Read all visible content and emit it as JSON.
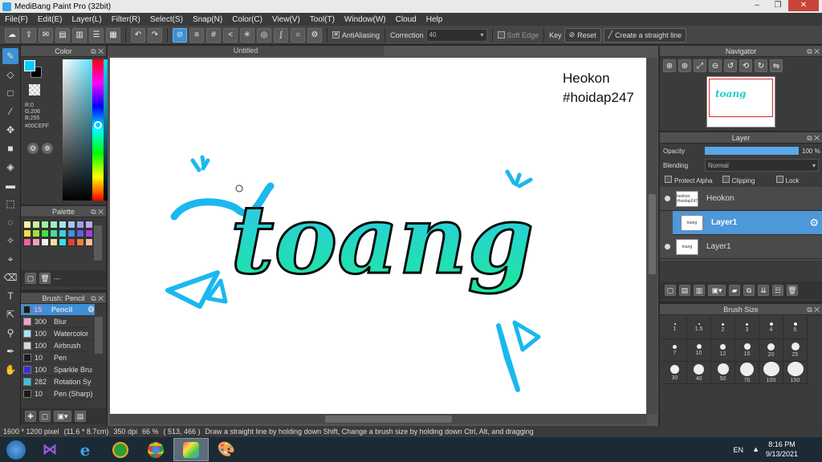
{
  "window": {
    "title": "MediBang Paint Pro (32bit)",
    "minimize": "–",
    "restore": "❐",
    "close": "✕"
  },
  "menu": [
    "File(F)",
    "Edit(E)",
    "Layer(L)",
    "Filter(R)",
    "Select(S)",
    "Snap(N)",
    "Color(C)",
    "View(V)",
    "Tool(T)",
    "Window(W)",
    "Cloud",
    "Help"
  ],
  "toolbar": {
    "antialiasing_label": "AntiAliasing",
    "antialiasing_checked": true,
    "correction_label": "Correction",
    "correction_value": "40",
    "soft_edge_label": "Soft Edge",
    "soft_edge_checked": false,
    "key_label": "Key",
    "reset_label": "Reset",
    "straight_line_label": "Create a straight line"
  },
  "color_panel": {
    "title": "Color",
    "r": "R:0",
    "g": "G:206",
    "b": "B:255",
    "hex": "#00CEFF",
    "foreground": "#00CEFF",
    "background": "#000000"
  },
  "palette_panel": {
    "title": "Palette",
    "swatches": [
      "#f4f4a0",
      "#c8f0a0",
      "#a0f0a0",
      "#a0f0c8",
      "#a0e8f0",
      "#a0c8f0",
      "#a0a0f0",
      "#c8a0f0",
      "#f0e040",
      "#a0e040",
      "#40e040",
      "#40e0a0",
      "#40d0e0",
      "#4090e0",
      "#6060e0",
      "#a040e0",
      "#f060a0",
      "#f0a0c0",
      "#f0f0f0",
      "#f0e0a0",
      "#40e0e0",
      "#e04040",
      "#f08040",
      "#f0c0a0"
    ],
    "name_placeholder": "---"
  },
  "brush_panel": {
    "title": "Brush: Pencil",
    "brushes": [
      {
        "size": "15",
        "name": "Pencil",
        "color": "#1a1a1a",
        "selected": true
      },
      {
        "size": "300",
        "name": "Blur",
        "color": "#f0a0d0",
        "selected": false
      },
      {
        "size": "100",
        "name": "Watercolor",
        "color": "#a0e8f8",
        "selected": false
      },
      {
        "size": "100",
        "name": "Airbrush",
        "color": "#d8d8d8",
        "selected": false
      },
      {
        "size": "10",
        "name": "Pen",
        "color": "#1a1a1a",
        "selected": false
      },
      {
        "size": "100",
        "name": "Sparkle Brush",
        "color": "#3030e0",
        "selected": false
      },
      {
        "size": "282",
        "name": "Rotation Sy",
        "color": "#40c0e0",
        "selected": false
      },
      {
        "size": "10",
        "name": "Pen (Sharp)",
        "color": "#1a1a1a",
        "selected": false
      }
    ]
  },
  "canvas": {
    "tab_title": "Untitled",
    "watermark_line1": "Heokon",
    "watermark_line2": "#hoidap247",
    "artwork_text": "toang"
  },
  "navigator": {
    "title": "Navigator"
  },
  "layer_panel": {
    "title": "Layer",
    "opacity_label": "Opacity",
    "opacity_value": "100 %",
    "opacity_level": 1.0,
    "blending_label": "Blending",
    "blending_value": "Normal",
    "protect_alpha_label": "Protect Alpha",
    "clipping_label": "Clipping",
    "lock_label": "Lock",
    "layers": [
      {
        "name": "Heokon",
        "thumb": "heokon #hoidap247",
        "selected": false
      },
      {
        "name": "Layer1",
        "thumb": "toang",
        "selected": true
      },
      {
        "name": "Layer1",
        "thumb": "toang",
        "selected": false
      }
    ]
  },
  "brush_size_panel": {
    "title": "Brush Size",
    "sizes": [
      "1",
      "1.5",
      "2",
      "3",
      "4",
      "5",
      "7",
      "10",
      "12",
      "15",
      "20",
      "25",
      "30",
      "40",
      "50",
      "70",
      "100",
      "150"
    ]
  },
  "status": {
    "dimensions": "1600 * 1200 pixel",
    "physical": "(11.6 * 8.7cm)",
    "dpi": "350 dpi",
    "zoom": "66 %",
    "coords": "( 513, 466 )",
    "hint": "Draw a straight line by holding down Shift, Change a brush size by holding down Ctrl, Alt, and dragging"
  },
  "taskbar": {
    "lang": "EN",
    "time": "8:16 PM",
    "date": "9/13/2021"
  }
}
